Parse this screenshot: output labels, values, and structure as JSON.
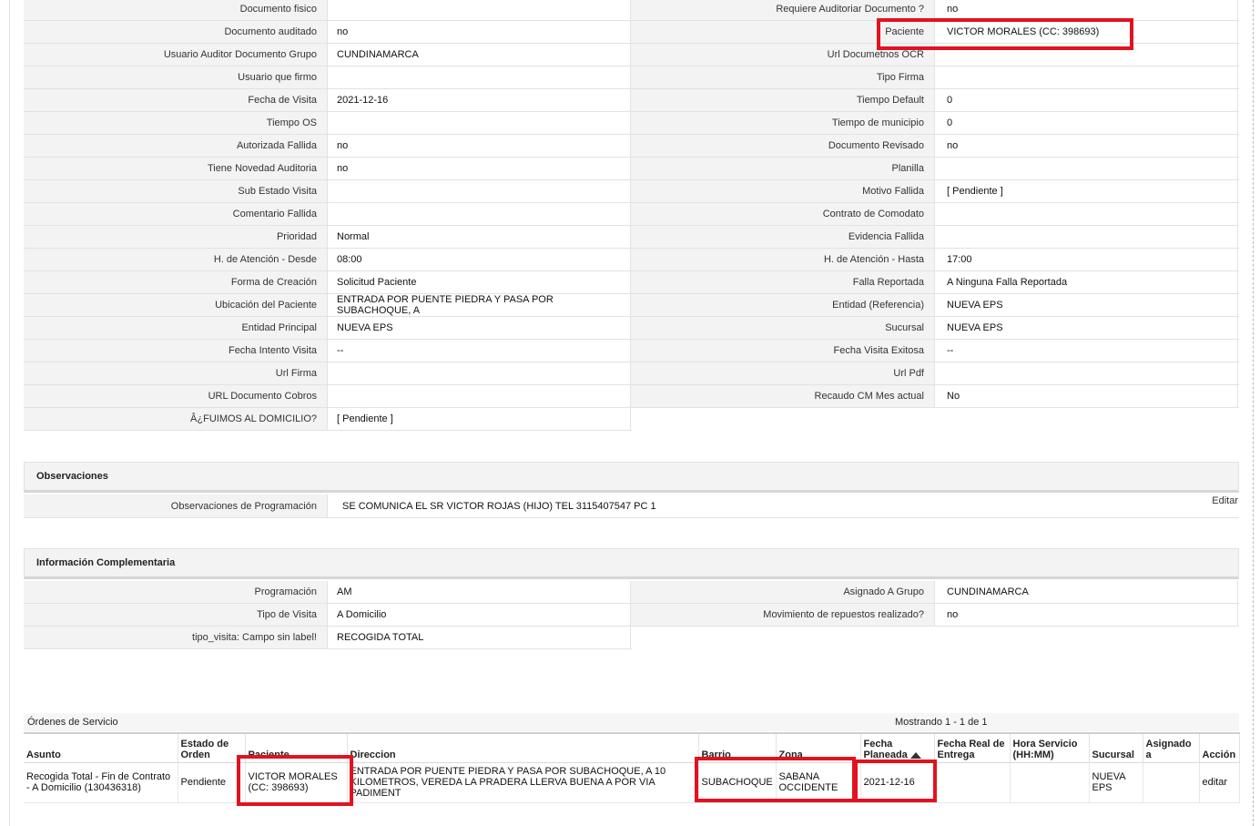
{
  "details": {
    "rows": [
      {
        "l1": "Documento fisico",
        "v1": "",
        "l2": "Requiere Auditoriar Documento ?",
        "v2": "no"
      },
      {
        "l1": "Documento auditado",
        "v1": "no",
        "l2": "Paciente",
        "v2": "VICTOR MORALES (CC: 398693)"
      },
      {
        "l1": "Usuario Auditor Documento Grupo",
        "v1": "CUNDINAMARCA",
        "l2": "Url Documetnos OCR",
        "v2": ""
      },
      {
        "l1": "Usuario que firmo",
        "v1": "",
        "l2": "Tipo Firma",
        "v2": ""
      },
      {
        "l1": "Fecha de Visita",
        "v1": "2021-12-16",
        "l2": "Tiempo Default",
        "v2": "0"
      },
      {
        "l1": "Tiempo OS",
        "v1": "",
        "l2": "Tiempo de municipio",
        "v2": "0"
      },
      {
        "l1": "Autorizada Fallida",
        "v1": "no",
        "l2": "Documento Revisado",
        "v2": "no"
      },
      {
        "l1": "Tiene Novedad Auditoria",
        "v1": "no",
        "l2": "Planilla",
        "v2": ""
      },
      {
        "l1": "Sub Estado Visita",
        "v1": "",
        "l2": "Motivo Fallida",
        "v2": "[ Pendiente ]"
      },
      {
        "l1": "Comentario Fallida",
        "v1": "",
        "l2": "Contrato de Comodato",
        "v2": ""
      },
      {
        "l1": "Prioridad",
        "v1": "Normal",
        "l2": "Evidencia Fallida",
        "v2": ""
      },
      {
        "l1": "H. de Atención - Desde",
        "v1": "08:00",
        "l2": "H. de Atención - Hasta",
        "v2": "17:00"
      },
      {
        "l1": "Forma de Creación",
        "v1": "Solicitud Paciente",
        "l2": "Falla Reportada",
        "v2": "A Ninguna Falla Reportada"
      },
      {
        "l1": "Ubicación del Paciente",
        "v1": "ENTRADA POR PUENTE PIEDRA Y PASA POR SUBACHOQUE, A",
        "l2": "Entidad (Referencia)",
        "v2": "NUEVA EPS"
      },
      {
        "l1": "Entidad Principal",
        "v1": "NUEVA EPS",
        "l2": "Sucursal",
        "v2": "NUEVA EPS"
      },
      {
        "l1": "Fecha Intento Visita",
        "v1": "--",
        "l2": "Fecha Visita Exitosa",
        "v2": "--"
      },
      {
        "l1": "Url Firma",
        "v1": "",
        "l2": "Url Pdf",
        "v2": ""
      },
      {
        "l1": "URL Documento Cobros",
        "v1": "",
        "l2": "Recaudo CM Mes actual",
        "v2": "No"
      }
    ],
    "last": {
      "l1": "Â¿FUIMOS AL DOMICILIO?",
      "v1": "[ Pendiente ]"
    }
  },
  "observaciones": {
    "title": "Observaciones",
    "label": "Observaciones de Programación",
    "value": "SE COMUNICA EL SR VICTOR ROJAS (HIJO) TEL 3115407547 PC 1",
    "edit": "Editar"
  },
  "complementaria": {
    "title": "Información Complementaria",
    "rows": [
      {
        "l1": "Programación",
        "v1": "AM",
        "l2": "Asignado A Grupo",
        "v2": "CUNDINAMARCA"
      },
      {
        "l1": "Tipo de Visita",
        "v1": "A Domicilio",
        "l2": "Movimiento de repuestos realizado?",
        "v2": "no"
      }
    ],
    "last": {
      "l1": "tipo_visita: Campo sin label!",
      "v1": "RECOGIDA TOTAL"
    }
  },
  "ordenes": {
    "title": "Órdenes de Servicio",
    "count": "Mostrando 1 - 1 de 1",
    "headers": {
      "asunto": "Asunto",
      "estado": "Estado de Orden",
      "paciente": "Paciente",
      "direccion": "Direccion",
      "barrio": "Barrio",
      "zona": "Zona",
      "fecha_planeada": "Fecha Planeada",
      "fecha_real": "Fecha Real de Entrega",
      "hora": "Hora Servicio (HH:MM)",
      "sucursal": "Sucursal",
      "asignado": "Asignado a",
      "accion": "Acción"
    },
    "row": {
      "asunto": "Recogida Total - Fin de Contrato - A Domicilio (130436318)",
      "estado": "Pendiente",
      "paciente": "VICTOR MORALES (CC: 398693)",
      "direccion": "ENTRADA POR PUENTE PIEDRA Y PASA POR SUBACHOQUE, A 10 KILOMETROS, VEREDA LA PRADERA LLERVA BUENA A POR VIA PADIMENT",
      "barrio": "SUBACHOQUE",
      "zona": "SABANA OCCIDENTE",
      "fecha_planeada": "2021-12-16",
      "fecha_real": "",
      "hora": "",
      "sucursal": "NUEVA EPS",
      "asignado": "",
      "accion": "editar"
    }
  },
  "highlight_color": "#e2121f"
}
